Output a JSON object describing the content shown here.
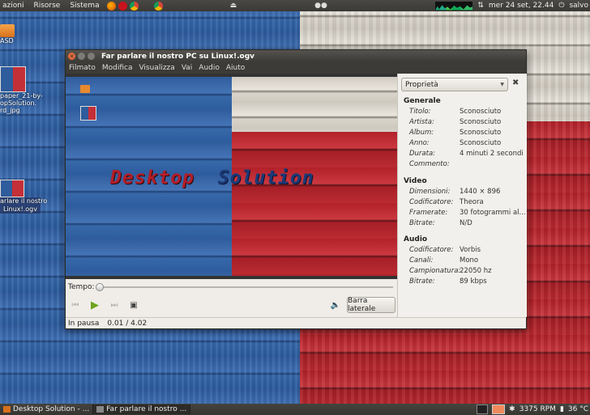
{
  "top_panel": {
    "menus": [
      "azioni",
      "Risorse",
      "Sistema"
    ],
    "datetime": "mer 24 set, 22.44",
    "user": "salvo"
  },
  "bottom_panel": {
    "tasks": [
      "Desktop Solution - ...",
      "Far parlare il nostro ..."
    ],
    "rpm": "3375 RPM",
    "temp": "36 °C"
  },
  "desktop": {
    "icon1": "ASD",
    "icon2": "paper_21-by-\nopSolution.\nrd_jpg",
    "icon3": "arlare il nostro\nLinux!.ogv"
  },
  "window": {
    "title": "Far parlare il nostro PC su Linux!.ogv",
    "menu": [
      "Filmato",
      "Modifica",
      "Visualizza",
      "Vai",
      "Audio",
      "Aiuto"
    ],
    "video_logo": [
      "Desktop",
      "Solution"
    ],
    "time_label": "Tempo:",
    "sidebar_button": "Barra laterale",
    "status_state": "In pausa",
    "status_time": "0.01 / 4.02",
    "position": 0.002
  },
  "sidebar": {
    "select": "Proprietà",
    "sections": {
      "general": "Generale",
      "video": "Video",
      "audio": "Audio"
    },
    "general": [
      {
        "k": "Titolo:",
        "v": "Sconosciuto"
      },
      {
        "k": "Artista:",
        "v": "Sconosciuto"
      },
      {
        "k": "Album:",
        "v": "Sconosciuto"
      },
      {
        "k": "Anno:",
        "v": "Sconosciuto"
      },
      {
        "k": "Durata:",
        "v": "4 minuti 2 secondi"
      },
      {
        "k": "Commento:",
        "v": ""
      }
    ],
    "video": [
      {
        "k": "Dimensioni:",
        "v": "1440 × 896"
      },
      {
        "k": "Codificatore:",
        "v": "Theora"
      },
      {
        "k": "Framerate:",
        "v": "30 fotogrammi al..."
      },
      {
        "k": "Bitrate:",
        "v": "N/D"
      }
    ],
    "audio": [
      {
        "k": "Codificatore:",
        "v": "Vorbis"
      },
      {
        "k": "Canali:",
        "v": "Mono"
      },
      {
        "k": "Campionatura:",
        "v": "22050 hz"
      },
      {
        "k": "Bitrate:",
        "v": "89 kbps"
      }
    ]
  },
  "colors": {
    "accent_play": "#6ca51d",
    "close_button": "#e56a3a"
  }
}
